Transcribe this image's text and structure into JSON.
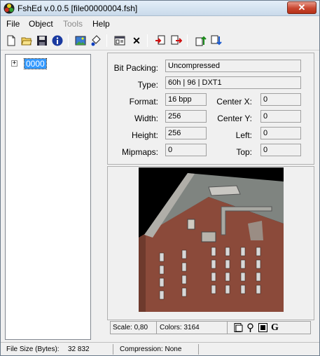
{
  "window": {
    "title": "FshEd v.0.0.5 [file00000004.fsh]",
    "close_glyph": "✕"
  },
  "menu": [
    {
      "label": "File",
      "enabled": true
    },
    {
      "label": "Object",
      "enabled": true
    },
    {
      "label": "Tools",
      "enabled": false
    },
    {
      "label": "Help",
      "enabled": true
    }
  ],
  "toolbar": {
    "icons": [
      "new-file-icon",
      "open-folder-icon",
      "save-disk-icon",
      "info-icon",
      "image-icon",
      "paint-icon",
      "properties-icon",
      "delete-icon",
      "import-icon",
      "export-icon",
      "move-up-icon",
      "move-down-icon"
    ],
    "delete_glyph": "✕"
  },
  "tree": {
    "expander": "+",
    "node_label": "0000"
  },
  "properties": {
    "bit_packing_label": "Bit Packing:",
    "bit_packing_value": "Uncompressed",
    "type_label": "Type:",
    "type_value": "60h | 96 | DXT1",
    "format_label": "Format:",
    "format_value": "16 bpp",
    "width_label": "Width:",
    "width_value": "256",
    "height_label": "Height:",
    "height_value": "256",
    "mipmaps_label": "Mipmaps:",
    "mipmaps_value": "0",
    "center_x_label": "Center X:",
    "center_x_value": "0",
    "center_y_label": "Center Y:",
    "center_y_value": "0",
    "left_label": "Left:",
    "left_value": "0",
    "top_label": "Top:",
    "top_value": "0"
  },
  "preview": {
    "scale_text": "Scale: 0,80",
    "colors_text": "Colors: 3164",
    "g_glyph": "G"
  },
  "statusbar": {
    "file_size_label": "File Size (Bytes):",
    "file_size_value": "32 832",
    "compression_text": "Compression: None"
  },
  "colors": {
    "selection": "#3399ff",
    "close_button": "#c8462f",
    "brick": "#8b4a3a"
  }
}
